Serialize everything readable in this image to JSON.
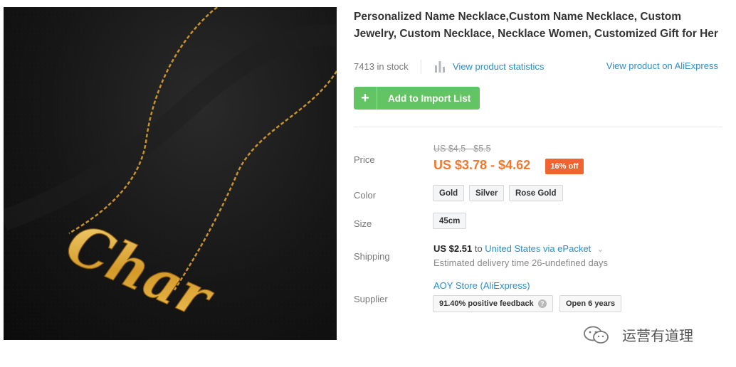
{
  "product": {
    "image_text": "Char",
    "title": "Personalized Name Necklace,Custom Name Necklace, Custom Jewelry, Custom Necklace, Necklace Women, Customized Gift for Her"
  },
  "meta": {
    "stock": "7413 in stock",
    "stats_link": "View product statistics",
    "aliexpress_link": "View product on AliExpress"
  },
  "actions": {
    "import_plus": "+",
    "import_label": "Add to Import List"
  },
  "labels": {
    "price": "Price",
    "color": "Color",
    "size": "Size",
    "shipping": "Shipping",
    "supplier": "Supplier"
  },
  "price": {
    "original": "US $4.5 - $5.5",
    "current": "US $3.78 - $4.62",
    "discount": "16% off"
  },
  "options": {
    "colors": [
      "Gold",
      "Silver",
      "Rose Gold"
    ],
    "sizes": [
      "45cm"
    ]
  },
  "shipping": {
    "price": "US $2.51",
    "to": "to",
    "destination_link": "United States via ePacket",
    "chevron": "⌄",
    "estimate": "Estimated delivery time 26-undefined days"
  },
  "supplier": {
    "name": "AOY Store (AliExpress)",
    "feedback": "91.40% positive feedback",
    "help": "?",
    "open": "Open 6 years"
  },
  "watermark": {
    "text": "运营有道理"
  },
  "colors": {
    "accent_link": "#2a8ec8",
    "import_green": "#62c462",
    "price_orange": "#f0782f",
    "discount_bg": "#f0652f"
  }
}
